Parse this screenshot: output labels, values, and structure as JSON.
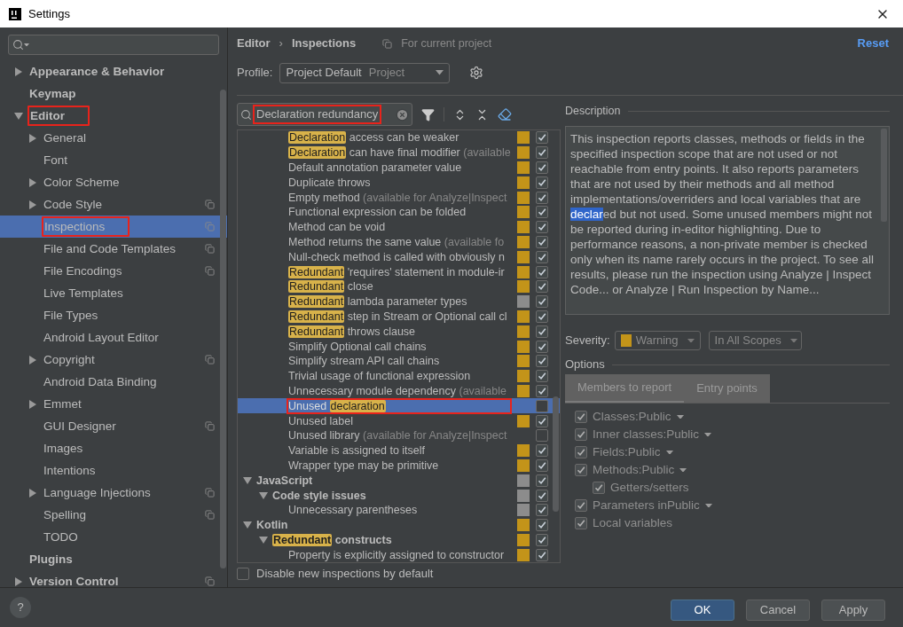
{
  "window": {
    "title": "Settings"
  },
  "sidebar": {
    "items": [
      {
        "label": "Appearance & Behavior",
        "kind": "group",
        "expanded": false,
        "bold": true,
        "selected": false,
        "annotated": false,
        "project_scoped": false
      },
      {
        "label": "Keymap",
        "kind": "leaf",
        "bold": true,
        "selected": false,
        "annotated": false,
        "project_scoped": false
      },
      {
        "label": "Editor",
        "kind": "group",
        "expanded": true,
        "bold": true,
        "selected": false,
        "annotated": true,
        "project_scoped": false,
        "children": [
          {
            "label": "General",
            "kind": "group",
            "expanded": false,
            "bold": false,
            "selected": false,
            "annotated": false,
            "project_scoped": false
          },
          {
            "label": "Font",
            "kind": "leaf",
            "bold": false,
            "selected": false,
            "annotated": false,
            "project_scoped": false
          },
          {
            "label": "Color Scheme",
            "kind": "group",
            "expanded": false,
            "bold": false,
            "selected": false,
            "annotated": false,
            "project_scoped": false
          },
          {
            "label": "Code Style",
            "kind": "group",
            "expanded": false,
            "bold": false,
            "selected": false,
            "annotated": false,
            "project_scoped": true
          },
          {
            "label": "Inspections",
            "kind": "leaf",
            "bold": false,
            "selected": true,
            "annotated": true,
            "project_scoped": true
          },
          {
            "label": "File and Code Templates",
            "kind": "leaf",
            "bold": false,
            "selected": false,
            "annotated": false,
            "project_scoped": true
          },
          {
            "label": "File Encodings",
            "kind": "leaf",
            "bold": false,
            "selected": false,
            "annotated": false,
            "project_scoped": true
          },
          {
            "label": "Live Templates",
            "kind": "leaf",
            "bold": false,
            "selected": false,
            "annotated": false,
            "project_scoped": false
          },
          {
            "label": "File Types",
            "kind": "leaf",
            "bold": false,
            "selected": false,
            "annotated": false,
            "project_scoped": false
          },
          {
            "label": "Android Layout Editor",
            "kind": "leaf",
            "bold": false,
            "selected": false,
            "annotated": false,
            "project_scoped": false
          },
          {
            "label": "Copyright",
            "kind": "group",
            "expanded": false,
            "bold": false,
            "selected": false,
            "annotated": false,
            "project_scoped": true
          },
          {
            "label": "Android Data Binding",
            "kind": "leaf",
            "bold": false,
            "selected": false,
            "annotated": false,
            "project_scoped": false
          },
          {
            "label": "Emmet",
            "kind": "group",
            "expanded": false,
            "bold": false,
            "selected": false,
            "annotated": false,
            "project_scoped": false
          },
          {
            "label": "GUI Designer",
            "kind": "leaf",
            "bold": false,
            "selected": false,
            "annotated": false,
            "project_scoped": true
          },
          {
            "label": "Images",
            "kind": "leaf",
            "bold": false,
            "selected": false,
            "annotated": false,
            "project_scoped": false
          },
          {
            "label": "Intentions",
            "kind": "leaf",
            "bold": false,
            "selected": false,
            "annotated": false,
            "project_scoped": false
          },
          {
            "label": "Language Injections",
            "kind": "group",
            "expanded": false,
            "bold": false,
            "selected": false,
            "annotated": false,
            "project_scoped": true
          },
          {
            "label": "Spelling",
            "kind": "leaf",
            "bold": false,
            "selected": false,
            "annotated": false,
            "project_scoped": true
          },
          {
            "label": "TODO",
            "kind": "leaf",
            "bold": false,
            "selected": false,
            "annotated": false,
            "project_scoped": false
          }
        ]
      },
      {
        "label": "Plugins",
        "kind": "leaf",
        "bold": true,
        "selected": false,
        "annotated": false,
        "project_scoped": false
      },
      {
        "label": "Version Control",
        "kind": "group",
        "expanded": false,
        "bold": true,
        "selected": false,
        "annotated": false,
        "project_scoped": true
      }
    ]
  },
  "breadcrumb": [
    "Editor",
    "›",
    "Inspections"
  ],
  "scope_note": "For current project",
  "reset": "Reset",
  "profile": {
    "label": "Profile:",
    "value": "Project Default",
    "hint": "Project"
  },
  "filter": {
    "value": "Declaration redundancy",
    "annotated": true
  },
  "inspections": [
    {
      "children": [
        {
          "children": [
            {
              "segments": [
                {
                  "text": "Declaration",
                  "kind": "match"
                },
                {
                  "text": " access can be weaker",
                  "kind": "plain"
                }
              ],
              "color": "#c39419",
              "checked": true,
              "selected": false,
              "annotated": false
            },
            {
              "segments": [
                {
                  "text": "Declaration",
                  "kind": "match"
                },
                {
                  "text": " can have final modifier ",
                  "kind": "plain"
                },
                {
                  "text": "(available",
                  "kind": "hint"
                }
              ],
              "color": "#c39419",
              "checked": true,
              "selected": false,
              "annotated": false
            },
            {
              "segments": [
                {
                  "text": "Default annotation parameter value",
                  "kind": "plain"
                }
              ],
              "color": "#c39419",
              "checked": true,
              "selected": false,
              "annotated": false
            },
            {
              "segments": [
                {
                  "text": "Duplicate throws",
                  "kind": "plain"
                }
              ],
              "color": "#c39419",
              "checked": true,
              "selected": false,
              "annotated": false
            },
            {
              "segments": [
                {
                  "text": "Empty method ",
                  "kind": "plain"
                },
                {
                  "text": "(available for Analyze|Inspect",
                  "kind": "hint"
                }
              ],
              "color": "#c39419",
              "checked": true,
              "selected": false,
              "annotated": false
            },
            {
              "segments": [
                {
                  "text": "Functional expression can be folded",
                  "kind": "plain"
                }
              ],
              "color": "#c39419",
              "checked": true,
              "selected": false,
              "annotated": false
            },
            {
              "segments": [
                {
                  "text": "Method can be void",
                  "kind": "plain"
                }
              ],
              "color": "#c39419",
              "checked": true,
              "selected": false,
              "annotated": false
            },
            {
              "segments": [
                {
                  "text": "Method returns the same value ",
                  "kind": "plain"
                },
                {
                  "text": "(available fo",
                  "kind": "hint"
                }
              ],
              "color": "#c39419",
              "checked": true,
              "selected": false,
              "annotated": false
            },
            {
              "segments": [
                {
                  "text": "Null-check method is called with obviously n",
                  "kind": "plain"
                }
              ],
              "color": "#c39419",
              "checked": true,
              "selected": false,
              "annotated": false
            },
            {
              "segments": [
                {
                  "text": "Redundant",
                  "kind": "match"
                },
                {
                  "text": " 'requires' statement in module-ir",
                  "kind": "plain"
                }
              ],
              "color": "#c39419",
              "checked": true,
              "selected": false,
              "annotated": false
            },
            {
              "segments": [
                {
                  "text": "Redundant",
                  "kind": "match"
                },
                {
                  "text": " close",
                  "kind": "plain"
                }
              ],
              "color": "#c39419",
              "checked": true,
              "selected": false,
              "annotated": false
            },
            {
              "segments": [
                {
                  "text": "Redundant",
                  "kind": "match"
                },
                {
                  "text": " lambda parameter types",
                  "kind": "plain"
                }
              ],
              "color": "#8c8c8c",
              "checked": true,
              "selected": false,
              "annotated": false
            },
            {
              "segments": [
                {
                  "text": "Redundant",
                  "kind": "match"
                },
                {
                  "text": " step in Stream or Optional call cl",
                  "kind": "plain"
                }
              ],
              "color": "#c39419",
              "checked": true,
              "selected": false,
              "annotated": false
            },
            {
              "segments": [
                {
                  "text": "Redundant",
                  "kind": "match"
                },
                {
                  "text": " throws clause",
                  "kind": "plain"
                }
              ],
              "color": "#c39419",
              "checked": true,
              "selected": false,
              "annotated": false
            },
            {
              "segments": [
                {
                  "text": "Simplify Optional call chains",
                  "kind": "plain"
                }
              ],
              "color": "#c39419",
              "checked": true,
              "selected": false,
              "annotated": false
            },
            {
              "segments": [
                {
                  "text": "Simplify stream API call chains",
                  "kind": "plain"
                }
              ],
              "color": "#c39419",
              "checked": true,
              "selected": false,
              "annotated": false
            },
            {
              "segments": [
                {
                  "text": "Trivial usage of functional expression",
                  "kind": "plain"
                }
              ],
              "color": "#c39419",
              "checked": true,
              "selected": false,
              "annotated": false
            },
            {
              "segments": [
                {
                  "text": "Unnecessary module dependency ",
                  "kind": "plain"
                },
                {
                  "text": "(available",
                  "kind": "hint"
                }
              ],
              "color": "#c39419",
              "checked": true,
              "selected": false,
              "annotated": false
            },
            {
              "segments": [
                {
                  "text": "Unused ",
                  "kind": "plain"
                },
                {
                  "text": "declaration",
                  "kind": "match"
                }
              ],
              "checked": false,
              "selected": true,
              "annotated": true
            },
            {
              "segments": [
                {
                  "text": "Unused label",
                  "kind": "plain"
                }
              ],
              "color": "#c39419",
              "checked": true,
              "selected": false,
              "annotated": false
            },
            {
              "segments": [
                {
                  "text": "Unused library ",
                  "kind": "plain"
                },
                {
                  "text": "(available for Analyze|Inspect",
                  "kind": "hint"
                }
              ],
              "checked": false,
              "selected": false,
              "annotated": false
            },
            {
              "segments": [
                {
                  "text": "Variable is assigned to itself",
                  "kind": "plain"
                }
              ],
              "color": "#c39419",
              "checked": true,
              "selected": false,
              "annotated": false
            },
            {
              "segments": [
                {
                  "text": "Wrapper type may be primitive",
                  "kind": "plain"
                }
              ],
              "color": "#c39419",
              "checked": true,
              "selected": false,
              "annotated": false
            }
          ]
        }
      ]
    },
    {
      "segments": [
        {
          "text": "JavaScript",
          "kind": "plain"
        }
      ],
      "color": "#8c8c8c",
      "checked": true,
      "selected": false,
      "annotated": false,
      "expanded": true,
      "children": [
        {
          "segments": [
            {
              "text": "Code style issues",
              "kind": "plain"
            }
          ],
          "color": "#8c8c8c",
          "checked": true,
          "selected": false,
          "annotated": false,
          "expanded": true,
          "children": [
            {
              "segments": [
                {
                  "text": "Unnecessary parentheses",
                  "kind": "plain"
                }
              ],
              "color": "#8c8c8c",
              "checked": true,
              "selected": false,
              "annotated": false
            }
          ]
        }
      ]
    },
    {
      "segments": [
        {
          "text": "Kotlin",
          "kind": "plain"
        }
      ],
      "color": "#c39419",
      "checked": true,
      "selected": false,
      "annotated": false,
      "expanded": true,
      "children": [
        {
          "segments": [
            {
              "text": "Redundant",
              "kind": "match"
            },
            {
              "text": " constructs",
              "kind": "plain"
            }
          ],
          "color": "#c39419",
          "checked": true,
          "selected": false,
          "annotated": false,
          "expanded": true,
          "children": [
            {
              "segments": [
                {
                  "text": "Property is explicitly assigned to constructor",
                  "kind": "plain"
                }
              ],
              "color": "#c39419",
              "checked": true,
              "selected": false,
              "annotated": false
            }
          ]
        }
      ]
    }
  ],
  "disable_new": {
    "label": "Disable new inspections by default",
    "checked": false
  },
  "description": {
    "title": "Description",
    "segments": [
      {
        "text": "This inspection reports classes, methods or fields in the specified inspection scope that are not used or not reachable from entry points. It also reports parameters that are not used by their methods and all method implementations/overriders and local variables that are ",
        "selected": false
      },
      {
        "text": "declar",
        "selected": true
      },
      {
        "text": "ed but not used. Some unused members might not be reported during in-editor highlighting. Due to performance reasons, a non-private member is checked only when its name rarely occurs in the project. To see all results, please run the inspection using Analyze | Inspect Code... or Analyze | Run Inspection by Name...",
        "selected": false
      }
    ]
  },
  "severity": {
    "label": "Severity:",
    "value": "Warning",
    "color": "#c39419",
    "scope": "In All Scopes"
  },
  "options": {
    "title": "Options",
    "tabs": [
      {
        "label": "Members to report",
        "selected": true
      },
      {
        "label": "Entry points",
        "selected": false
      }
    ],
    "items": [
      {
        "label": "Classes:Public",
        "checked": true,
        "dropdown": true
      },
      {
        "label": "Inner classes:Public",
        "checked": true,
        "dropdown": true
      },
      {
        "label": "Fields:Public",
        "checked": true,
        "dropdown": true
      },
      {
        "label": "Methods:Public",
        "checked": true,
        "dropdown": true,
        "children": [
          {
            "label": "Getters/setters",
            "checked": true,
            "dropdown": false
          }
        ]
      },
      {
        "label": "Parameters inPublic",
        "checked": true,
        "dropdown": true
      },
      {
        "label": "Local variables",
        "checked": true,
        "dropdown": false
      }
    ]
  },
  "help": "?",
  "buttons": [
    {
      "label": "OK",
      "primary": true
    },
    {
      "label": "Cancel",
      "primary": false
    },
    {
      "label": "Apply",
      "primary": false
    }
  ]
}
